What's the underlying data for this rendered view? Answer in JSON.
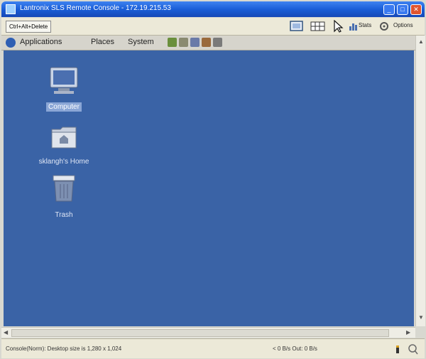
{
  "window": {
    "title": "Lantronix SLS Remote Console - 172.19.215.53"
  },
  "toolbar": {
    "cad_label": "Ctrl+Alt+Delete",
    "stats_label": "Stats",
    "options_label": "Options"
  },
  "panel": {
    "menus": [
      "Applications",
      "Places",
      "System"
    ]
  },
  "desktop": {
    "icons": [
      {
        "label": "Computer",
        "icon": "computer-icon",
        "selected": true
      },
      {
        "label": "sklangh's Home",
        "icon": "home-folder-icon",
        "selected": false
      },
      {
        "label": "Trash",
        "icon": "trash-icon",
        "selected": false
      }
    ]
  },
  "status": {
    "left": "Console(Norm): Desktop size is 1,280 x 1,024",
    "mid": "< 0 B/s Out: 0 B/s"
  },
  "colors": {
    "desktop_bg": "#3a63a6",
    "titlebar": "#1a5ed8",
    "panel_bg": "#d6d4cc"
  }
}
